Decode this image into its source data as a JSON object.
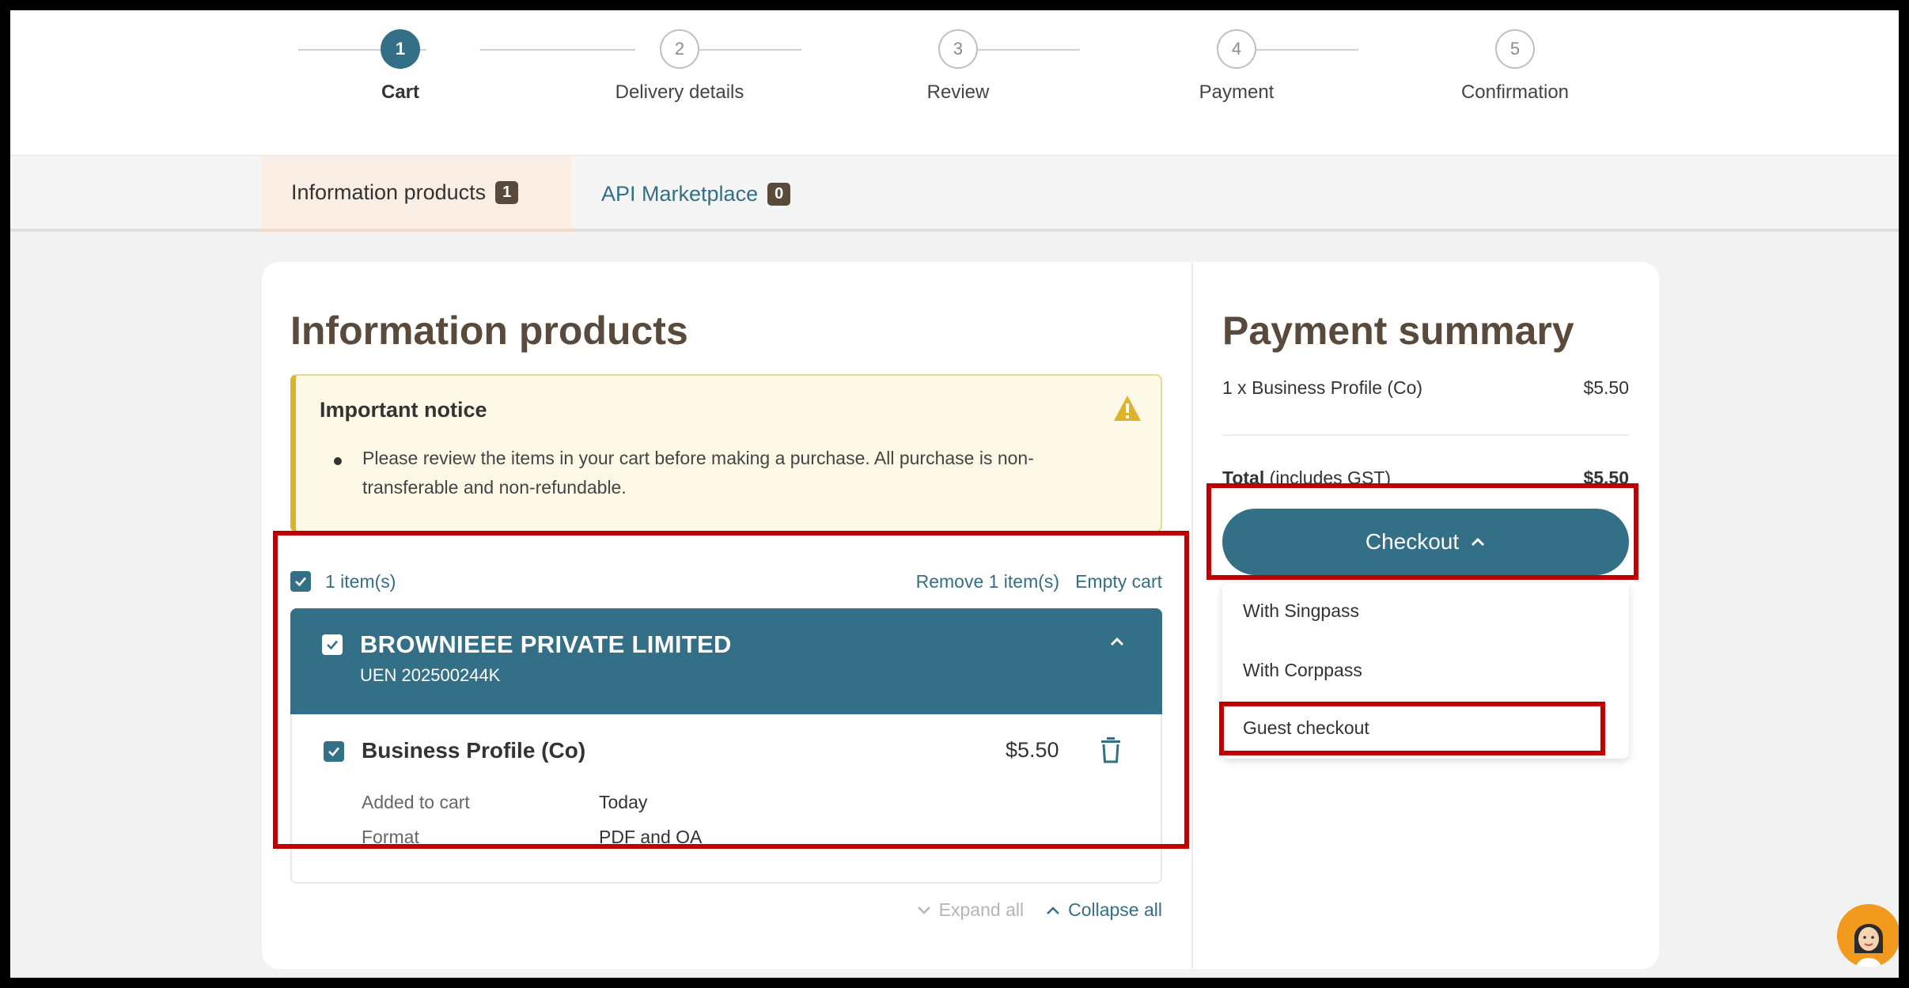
{
  "stepper": {
    "steps": [
      {
        "num": "1",
        "label": "Cart",
        "active": true
      },
      {
        "num": "2",
        "label": "Delivery details",
        "active": false
      },
      {
        "num": "3",
        "label": "Review",
        "active": false
      },
      {
        "num": "4",
        "label": "Payment",
        "active": false
      },
      {
        "num": "5",
        "label": "Confirmation",
        "active": false
      }
    ]
  },
  "tabs": [
    {
      "label": "Information products",
      "badge": "1",
      "active": true
    },
    {
      "label": "API Marketplace",
      "badge": "0",
      "active": false
    }
  ],
  "cart": {
    "heading": "Information products",
    "notice": {
      "title": "Important notice",
      "text": "Please review the items in your cart before making a purchase. All purchase is non-transferable and non-refundable."
    },
    "items_count": "1 item(s)",
    "remove_label": "Remove 1 item(s)",
    "empty_label": "Empty cart",
    "company": {
      "name": "BROWNIEEE PRIVATE LIMITED",
      "uen": "UEN 202500244K"
    },
    "product": {
      "name": "Business Profile (Co)",
      "price": "$5.50",
      "added_label": "Added to cart",
      "added_value": "Today",
      "format_label": "Format",
      "format_value": "PDF and OA"
    },
    "expand_all": "Expand all",
    "collapse_all": "Collapse all"
  },
  "payment": {
    "heading": "Payment summary",
    "line_item": "1 x Business Profile (Co)",
    "line_price": "$5.50",
    "total_label": "Total",
    "total_note": "(includes GST)",
    "total_value": "$5.50",
    "checkout_label": "Checkout",
    "options": [
      "With Singpass",
      "With Corppass",
      "Guest checkout"
    ]
  },
  "colors": {
    "primary": "#336f86",
    "heading_brown": "#5a4a3b",
    "highlight_red": "#c00000",
    "notice_bg": "#fdf9e6",
    "warn_yellow": "#e0b12a",
    "avatar_orange": "#f19a1d"
  },
  "icons": [
    "check-icon",
    "warning-icon",
    "chevron-up-icon",
    "chevron-down-icon",
    "trash-icon",
    "chat-avatar-icon"
  ]
}
